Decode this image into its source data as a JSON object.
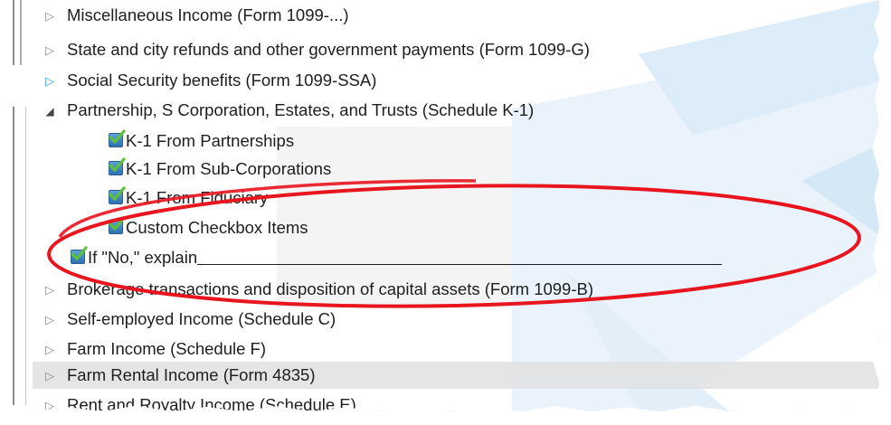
{
  "tree": {
    "items": [
      {
        "label": "Miscellaneous Income (Form 1099-...)",
        "state": "collapsed"
      },
      {
        "label": "State and city refunds and other government payments (Form 1099-G)",
        "state": "collapsed"
      },
      {
        "label": "Social Security benefits (Form 1099-SSA)",
        "state": "collapsed-blue"
      },
      {
        "label": "Partnership, S Corporation, Estates, and Trusts (Schedule K-1)",
        "state": "expanded"
      },
      {
        "label": "K-1 From Partnerships",
        "checked": true
      },
      {
        "label": "K-1 From Sub-Corporations",
        "checked": true
      },
      {
        "label": "K-1 From Fiduciary",
        "checked": true
      },
      {
        "label": "Custom Checkbox Items",
        "checked": true
      },
      {
        "label": "If \"No,\" explain",
        "checked": true
      },
      {
        "label": "Brokerage transactions and disposition of capital assets (Form 1099-B)",
        "state": "collapsed"
      },
      {
        "label": "Self-employed Income (Schedule C)",
        "state": "collapsed"
      },
      {
        "label": "Farm Income (Schedule F)",
        "state": "collapsed"
      },
      {
        "label": "Farm Rental Income (Form 4835)",
        "state": "collapsed",
        "selected": true
      },
      {
        "label": "Rent and Royalty Income (Schedule E)",
        "state": "collapsed"
      }
    ]
  },
  "colors": {
    "annotation_circle": "#e8141e",
    "checkbox_blue": "#2f6fb0",
    "checkmark_green": "#5cc23a",
    "expander_blue": "#3a9ae8"
  },
  "icons": {
    "collapsed": "triangle-right-icon",
    "expanded": "triangle-down-icon",
    "checkbox": "checkbox-checked-icon"
  }
}
